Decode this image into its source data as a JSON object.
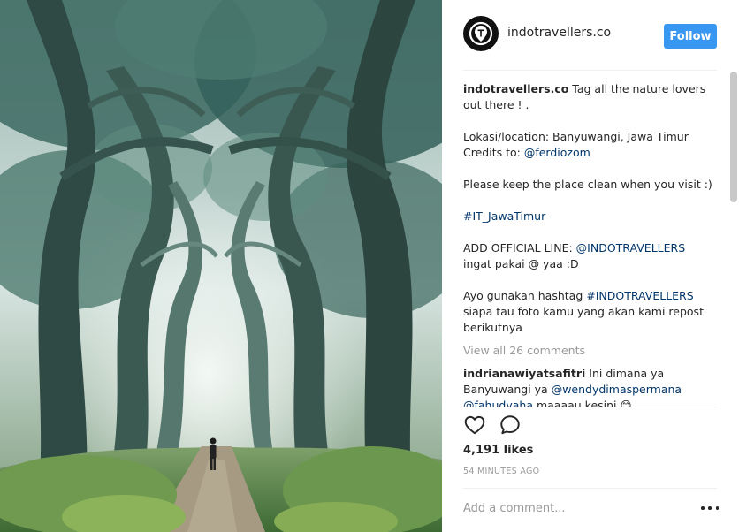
{
  "post": {
    "username": "indotravellers.co",
    "follow_label": "Follow",
    "image_alt": "Forest tunnel of twisted trees with a person walking on a path"
  },
  "caption": {
    "username": "indotravellers.co",
    "lines": [
      " Tag all the nature lovers",
      "out there ! ."
    ],
    "location_line": "Lokasi/location: Banyuwangi, Jawa Timur",
    "credits_prefix": "Credits to: ",
    "credits_handle": "@ferdiozom",
    "clean_line": "Please keep the place clean when you visit :) .",
    "hashtag1": "#IT_JawaTimur",
    "official_prefix": "ADD OFFICIAL LINE: ",
    "official_handle": "@INDOTRAVELLERS",
    "official_line2": "ingat pakai @ yaa :D",
    "hashtag_prefix": "Ayo gunakan hashtag ",
    "hashtag2": "#INDOTRAVELLERS",
    "repost_line1": "siapa tau foto kamu yang akan kami repost",
    "repost_line2": "berikutnya"
  },
  "view_all_comments": "View all 26 comments",
  "comment": {
    "username": "indrianawiyatsafitri",
    "text1": " Ini dimana ya",
    "text2": "Banyuwangi ya ",
    "mention1": "@wendydimaspermana",
    "mention2": "@fahudyaha",
    "text3": " maaaau kesini 😊"
  },
  "actions": {
    "like_icon": "heart-icon",
    "comment_icon": "comment-bubble-icon"
  },
  "likes": "4,191 likes",
  "time_ago": "54 MINUTES AGO",
  "add_comment_placeholder": "Add a comment...",
  "more_icon": "more-options-icon",
  "colors": {
    "follow_button": "#3897f0",
    "link": "#003569",
    "muted": "#999999",
    "text": "#262626"
  }
}
